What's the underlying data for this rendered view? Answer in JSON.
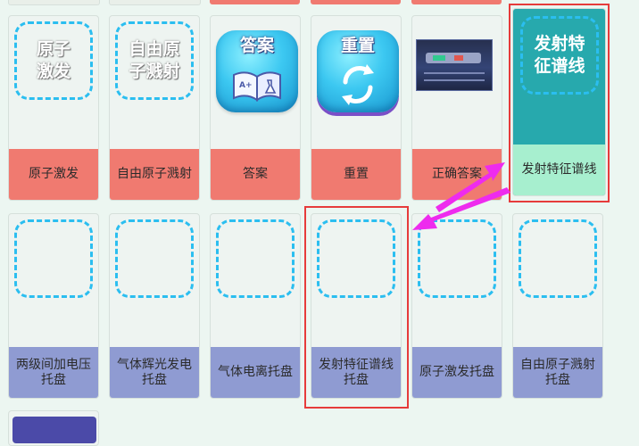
{
  "row1": [
    {
      "placeholder": "原子\n激发",
      "label": "原子激发"
    },
    {
      "placeholder": "自由原\n子溅射",
      "label": "自由原子溅射"
    },
    {
      "title": "答案",
      "label": "答案"
    },
    {
      "title": "重置",
      "label": "重置"
    },
    {
      "label": "正确答案"
    },
    {
      "placeholder": "发射特\n征谱线",
      "label": "发射特征谱线"
    }
  ],
  "row2": [
    {
      "label": "两级间加电压托盘"
    },
    {
      "label": "气体辉光发电托盘"
    },
    {
      "label": "气体电离托盘"
    },
    {
      "label": "发射特征谱线托盘"
    },
    {
      "label": "原子激发托盘"
    },
    {
      "label": "自由原子溅射托盘"
    }
  ],
  "colors": {
    "red_label": "#f07a70",
    "blue_label": "#8f9bd2",
    "mint_label": "#a7efcf",
    "dashed_border": "#2bbef0",
    "highlight_frame": "#e63b3b",
    "arrow": "#ee2bee",
    "teal_card": "#27a9ad"
  },
  "icons": [
    "answer-book-icon",
    "refresh-icon",
    "pink-arrow-icon"
  ]
}
